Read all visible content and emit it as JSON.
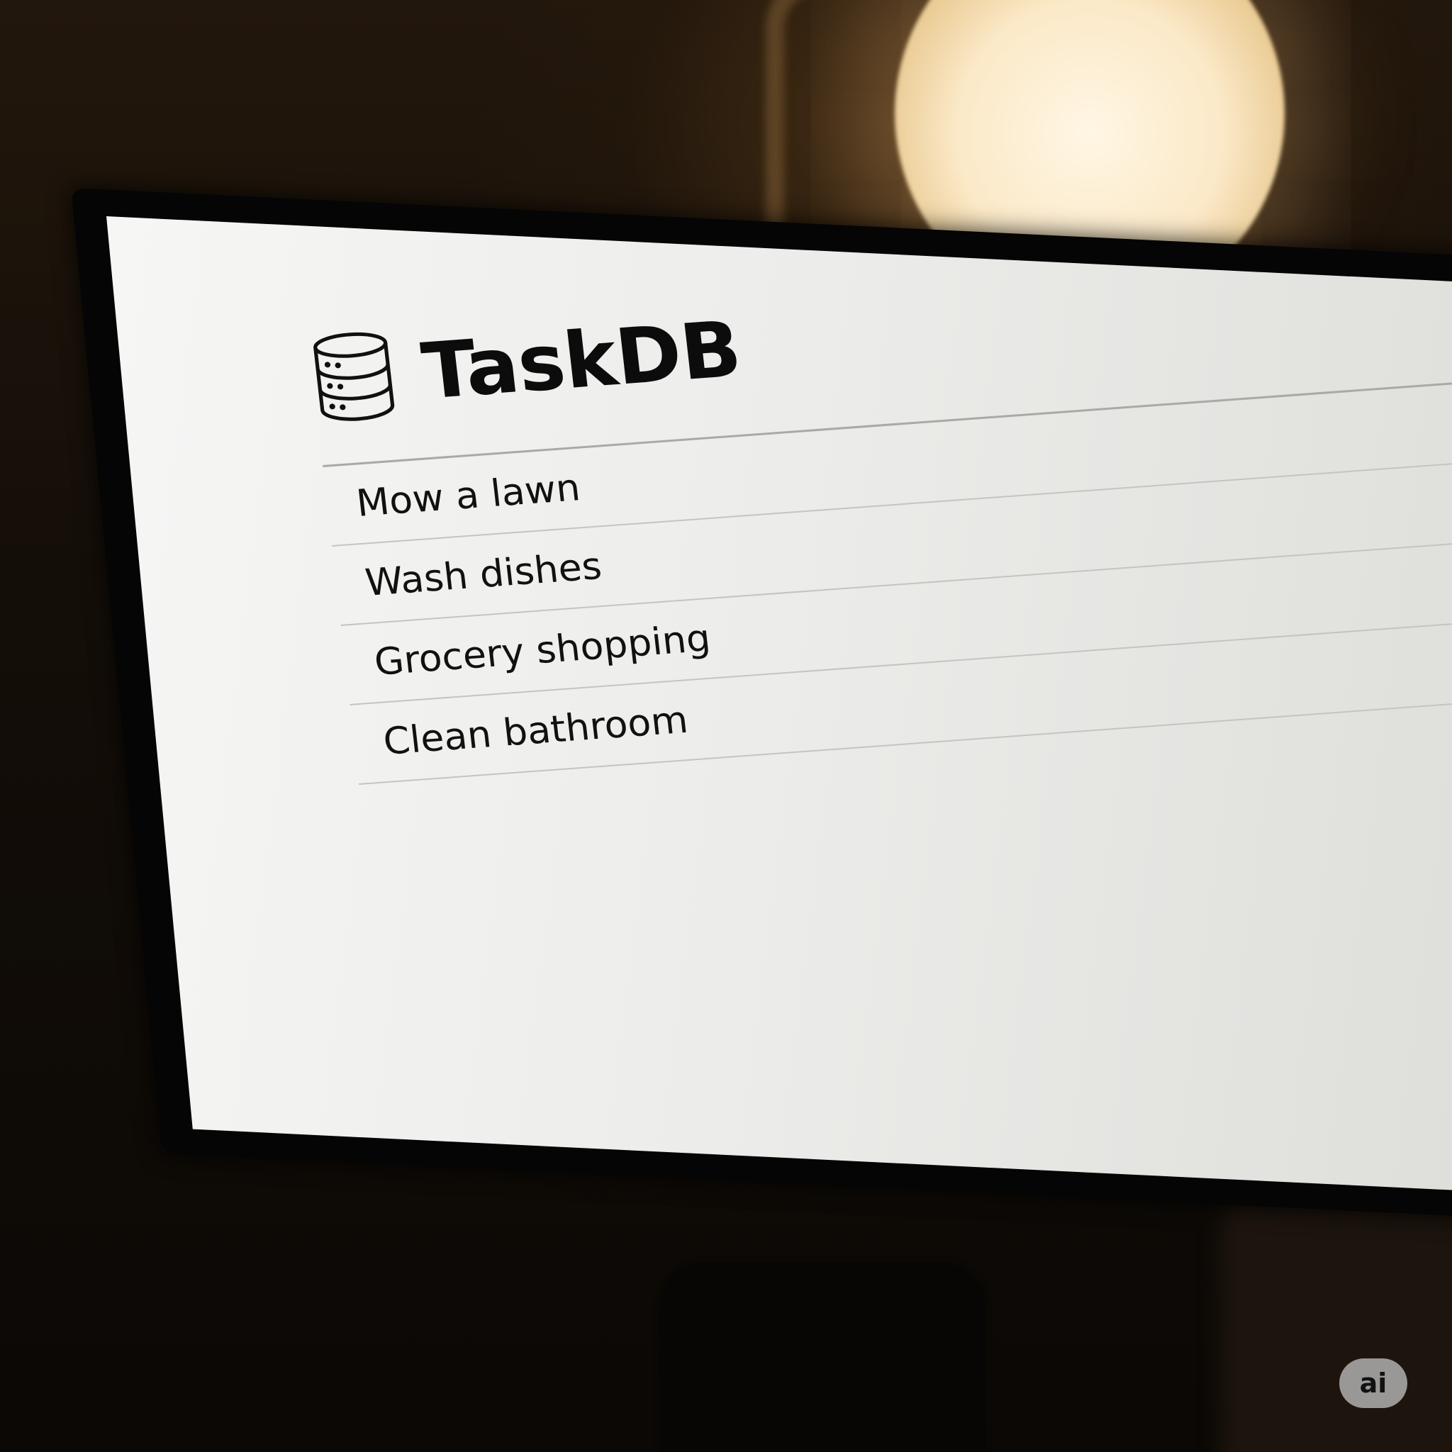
{
  "app": {
    "title": "TaskDB",
    "logo_icon": "database-icon"
  },
  "tasks": [
    {
      "label": "Mow a lawn"
    },
    {
      "label": "Wash dishes"
    },
    {
      "label": "Grocery shopping"
    },
    {
      "label": "Clean bathroom"
    }
  ],
  "watermark": {
    "text": "ai"
  },
  "colors": {
    "screen_background": "#ececea",
    "text": "#111111",
    "divider": "#a9a9a6"
  }
}
